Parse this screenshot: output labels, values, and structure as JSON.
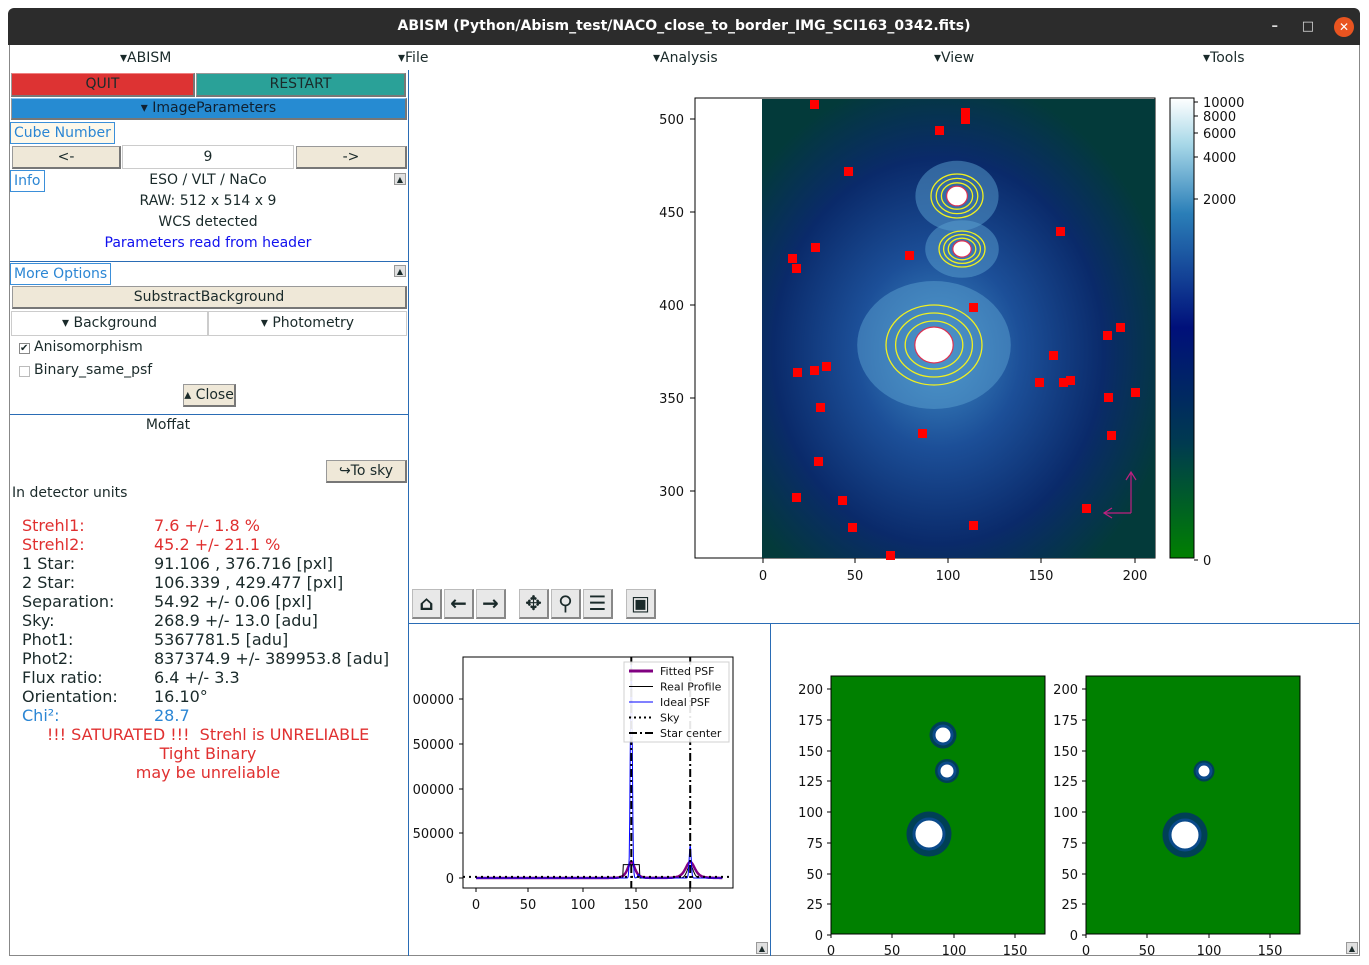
{
  "window": {
    "title": "ABISM (Python/Abism_test/NACO_close_to_border_IMG_SCI163_0342.fits)",
    "minimize": "–",
    "maximize": "□",
    "close": "✕"
  },
  "menu": [
    "▾ABISM",
    "▾File",
    "▾Analysis",
    "▾View",
    "▾Tools"
  ],
  "left": {
    "quit": "QUIT",
    "restart": "RESTART",
    "image_parameters": "▾ ImageParameters",
    "cube_label": "Cube Number",
    "prev": "<-",
    "cube_value": "9",
    "next": "->",
    "info_label": "Info",
    "info": [
      "ESO / VLT / NaCo",
      "RAW: 512 x 514 x 9",
      "WCS detected"
    ],
    "info_header": "Parameters read from header",
    "more_options": "More Options",
    "subtract_bg": "SubstractBackground",
    "background": "▾ Background",
    "photometry": "▾ Photometry",
    "anisomorphism": "Anisomorphism",
    "anisomorphism_checked": true,
    "binary_same_psf": "Binary_same_psf",
    "binary_same_psf_checked": false,
    "close": "▴ Close",
    "fit_type": "Moffat",
    "to_sky": "↪To sky",
    "units": "In detector units",
    "results": [
      {
        "k": "Strehl1:",
        "v": "7.6 +/- 1.8 %",
        "color": "#e03030"
      },
      {
        "k": "Strehl2:",
        "v": "45.2 +/- 21.1 %",
        "color": "#e03030"
      },
      {
        "k": "1 Star:",
        "v": "91.106 , 376.716 [pxl]"
      },
      {
        "k": "2 Star:",
        "v": "106.339 , 429.477 [pxl]"
      },
      {
        "k": "Separation:",
        "v": "54.92 +/- 0.06 [pxl]"
      },
      {
        "k": "Sky:",
        "v": "268.9 +/- 13.0 [adu]"
      },
      {
        "k": "Phot1:",
        "v": "5367781.5 [adu]"
      },
      {
        "k": "Phot2:",
        "v": "837374.9 +/- 389953.8 [adu]"
      },
      {
        "k": "Flux ratio:",
        "v": "6.4 +/- 3.3"
      },
      {
        "k": "Orientation:",
        "v": "16.10°"
      },
      {
        "k": "Chi²:",
        "v": "28.7",
        "color": "#2b86d4"
      }
    ],
    "warnings": [
      "!!! SATURATED !!!  Strehl is UNRELIABLE",
      "Tight Binary",
      "may be unreliable"
    ]
  },
  "toolbar": [
    "home-icon",
    "back-icon",
    "forward-icon",
    "pan-icon",
    "zoom-icon",
    "configure-icon",
    "save-icon"
  ],
  "main_image": {
    "xticks": [
      "0",
      "50",
      "100",
      "150",
      "200"
    ],
    "yticks": [
      "500",
      "450",
      "400",
      "350",
      "300"
    ],
    "colorbar_ticks": [
      "10000",
      "8000",
      "6000",
      "4000",
      "2000",
      "0"
    ],
    "colormap": "ocean"
  },
  "profile": {
    "yticks": [
      "00000",
      "50000",
      "00000",
      "50000",
      "0"
    ],
    "xticks": [
      "0",
      "50",
      "100",
      "150",
      "200"
    ],
    "legend": [
      "Fitted PSF",
      "Real Profile",
      "Ideal PSF",
      "Sky",
      "Star center"
    ],
    "colors": {
      "fitted": "#800080",
      "real": "#000000",
      "ideal": "#0000ff"
    }
  },
  "thumbs": {
    "yticks": [
      "200",
      "175",
      "150",
      "125",
      "100",
      "75",
      "50",
      "25",
      "0"
    ],
    "xticks": [
      "0",
      "50",
      "100",
      "150"
    ]
  }
}
